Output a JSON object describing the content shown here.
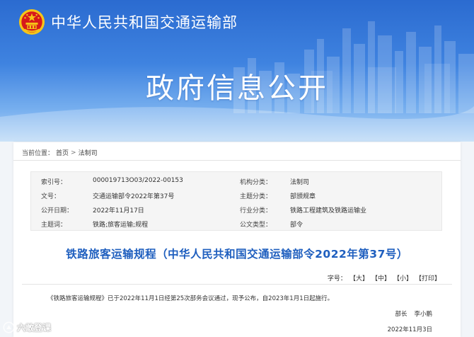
{
  "header": {
    "ministry_name": "中华人民共和国交通运输部",
    "banner_title": "政府信息公开"
  },
  "breadcrumb": {
    "label": "当前位置：",
    "items": [
      "首页",
      "法制司"
    ],
    "separator": ">"
  },
  "metadata": {
    "rows": [
      {
        "k1": "索引号：",
        "v1": "000019713O03/2022-00153",
        "k2": "机构分类：",
        "v2": "法制司"
      },
      {
        "k1": "文号：",
        "v1": "交通运输部令2022年第37号",
        "k2": "主题分类：",
        "v2": "部颁规章"
      },
      {
        "k1": "公开日期：",
        "v1": "2022年11月17日",
        "k2": "行业分类：",
        "v2": "铁路工程建筑及铁路运输业"
      },
      {
        "k1": "主题词：",
        "v1": "铁路;旅客运输;规程",
        "k2": "公文类型：",
        "v2": "部令"
      }
    ]
  },
  "document": {
    "title": "铁路旅客运输规程（中华人民共和国交通运输部令2022年第37号）",
    "body": "《铁路旅客运输规程》已于2022年11月1日经第25次部务会议通过，现予公布，自2023年1月1日起施行。",
    "signer_title": "部长",
    "signer_name": "李小鹏",
    "date": "2022年11月3日"
  },
  "font_size_bar": {
    "label": "字号：",
    "large": "【大】",
    "medium": "【中】",
    "small": "【小】",
    "print": "【打印】"
  },
  "watermark": {
    "text": "六敢登课"
  },
  "colors": {
    "banner_top": "#2b6bd0",
    "title_blue": "#1f5fbf",
    "emblem_red": "#d7191b",
    "emblem_gold": "#f5c518"
  },
  "icons": {
    "emblem": "national-emblem-icon",
    "watermark": "watermark-logo-icon"
  }
}
